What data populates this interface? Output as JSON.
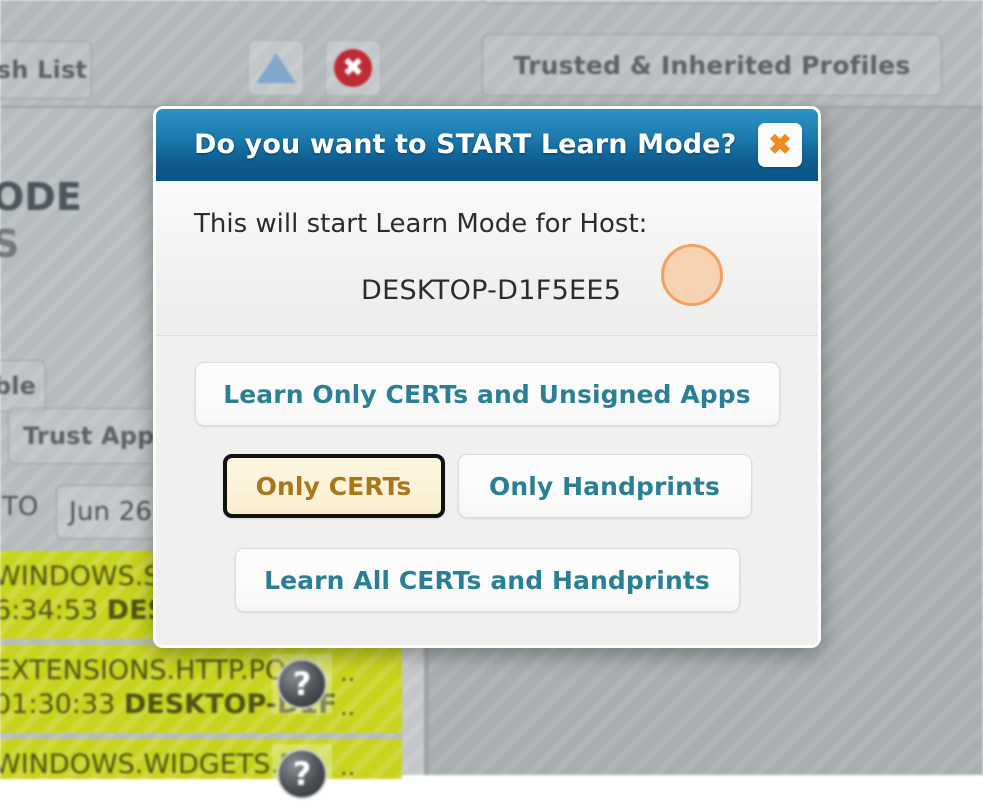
{
  "background": {
    "buttons": {
      "hash_list": "sh List",
      "trusted_profiles": "Trusted & Inherited Profiles",
      "enable": "ble",
      "trust_app": "Trust App",
      "date_field": "Jun 26 2"
    },
    "labels": {
      "mode_heading": "ODE",
      "sub_heading": "S",
      "to_label": "TO"
    },
    "icons": {
      "move_up": "triangle-up-icon",
      "delete": "delete-circle-icon",
      "help": "question-mark-icon"
    },
    "log_rows": [
      {
        "line1": "WINDOWS.S",
        "line2_time": "6:34:53 ",
        "line2_host": "DESI",
        "ellipsis": ""
      },
      {
        "line1": "EXTENSIONS.HTTP.PO",
        "line2_time": "01:30:33 ",
        "line2_host": "DESKTOP-D1F",
        "ellipsis": ".."
      },
      {
        "line1": "WINDOWS.WIDGETS.P",
        "line2_time": "",
        "line2_host": "",
        "ellipsis": ".."
      }
    ]
  },
  "dialog": {
    "title": "Do you want to START Learn Mode?",
    "close_icon": "✖",
    "close_icon_name": "close-icon",
    "message_primary": "This will start Learn Mode for Host:",
    "host_name": "DESKTOP-D1F5EE5",
    "buttons": {
      "learn_certs_unsigned": "Learn Only CERTs and Unsigned Apps",
      "only_certs": "Only CERTs",
      "only_handprints": "Only Handprints",
      "learn_all": "Learn All CERTs and Handprints"
    },
    "selected_button": "Only CERTs",
    "colors": {
      "titlebar_top": "#2f93c6",
      "titlebar_bottom": "#0a5486",
      "button_text": "#2b7f94",
      "selected_button_bg": "#fbf2d8",
      "selected_button_text": "#a8761c",
      "close_icon": "#ef8b21",
      "cursor_highlight_fill": "#f6d2b0",
      "cursor_highlight_border": "#f3a162",
      "log_row_bg": "#c7d31d",
      "desktop_bg": "#a9afb1"
    }
  }
}
